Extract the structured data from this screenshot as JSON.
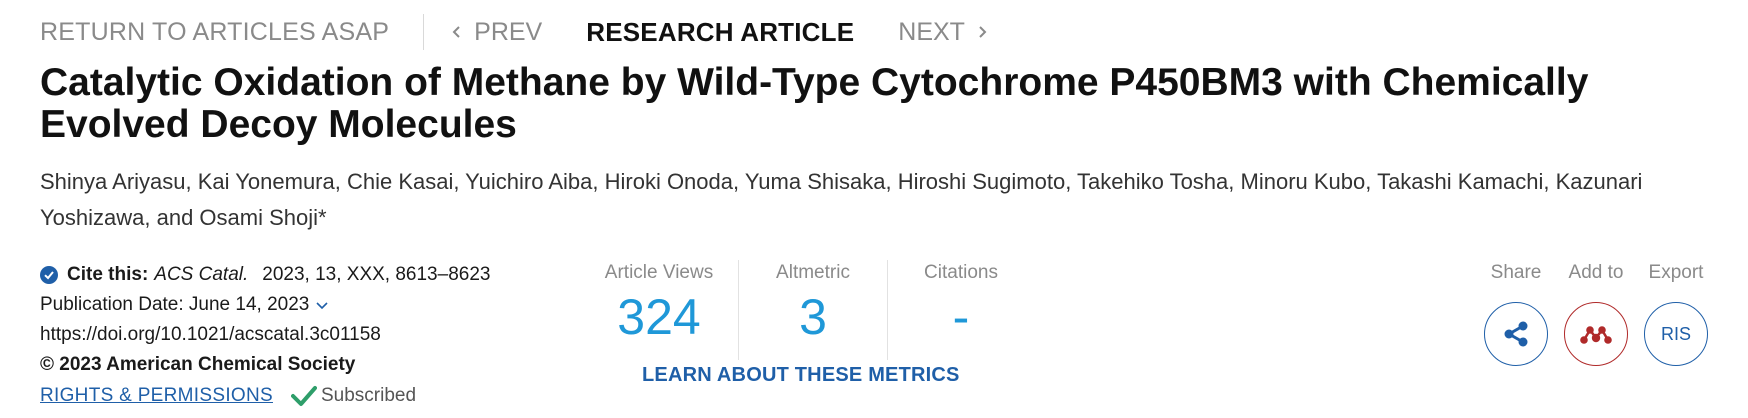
{
  "nav": {
    "return_label": "RETURN TO ARTICLES ASAP",
    "prev_label": "PREV",
    "article_type": "RESEARCH ARTICLE",
    "next_label": "NEXT"
  },
  "article": {
    "title": "Catalytic Oxidation of Methane by Wild-Type Cytochrome P450BM3 with Chemically Evolved Decoy Molecules",
    "authors": "Shinya Ariyasu, Kai Yonemura, Chie Kasai, Yuichiro Aiba, Hiroki Onoda, Yuma Shisaka, Hiroshi Sugimoto, Takehiko Tosha, Minoru Kubo, Takashi Kamachi, Kazunari Yoshizawa, and Osami Shoji*"
  },
  "citation": {
    "label": "Cite this:",
    "journal": "ACS Catal.",
    "details": "2023, 13, XXX, 8613–8623",
    "publication_date": "Publication Date: June 14, 2023",
    "doi": "https://doi.org/10.1021/acscatal.3c01158",
    "copyright": "© 2023 American Chemical Society",
    "rights_link": "RIGHTS & PERMISSIONS",
    "subscribed_label": "Subscribed"
  },
  "metrics": {
    "views_label": "Article Views",
    "views_value": "324",
    "altmetric_label": "Altmetric",
    "altmetric_value": "3",
    "citations_label": "Citations",
    "citations_value": "-",
    "learn_link": "LEARN ABOUT THESE METRICS"
  },
  "actions": {
    "share_label": "Share",
    "add_label": "Add to",
    "export_label": "Export",
    "ris_label": "RIS"
  },
  "colors": {
    "accent_blue": "#1f5fa8",
    "metric_blue": "#1f98d8",
    "subscribed_green": "#2e9e6a",
    "mendeley_red": "#b02a2a",
    "muted_gray": "#8a8a8a"
  },
  "icons": {
    "prev": "chevron-left-icon",
    "next": "chevron-right-icon",
    "cite": "check-circle-icon",
    "pub_date": "chevron-down-icon",
    "subscribed": "checkmark-icon",
    "share": "share-icon",
    "add_to": "mendeley-icon"
  }
}
